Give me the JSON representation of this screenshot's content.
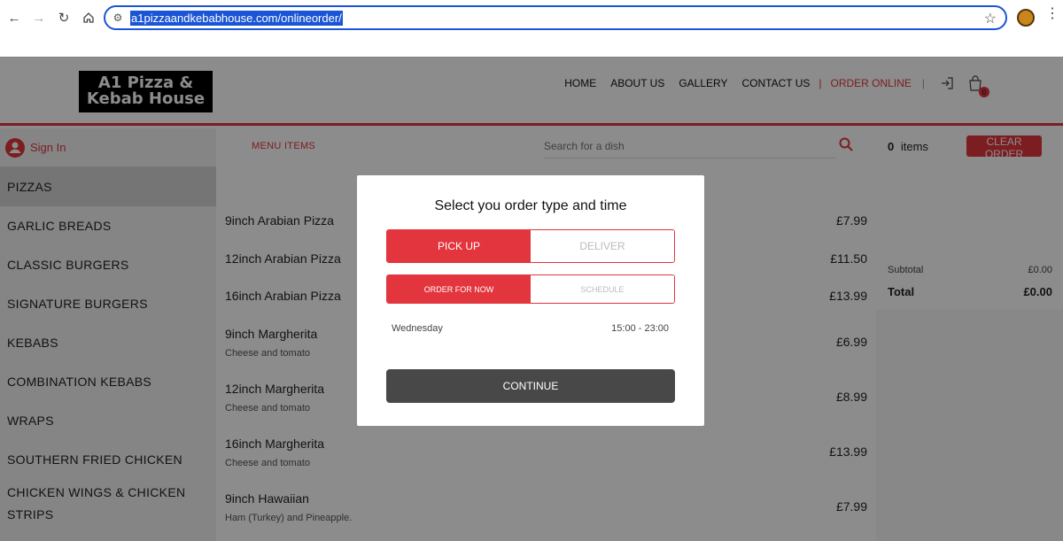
{
  "browser": {
    "url": "a1pizzaandkebabhouse.com/onlineorder/"
  },
  "site": {
    "logo_line1": "A1 Pizza &",
    "logo_line2": "Kebab House",
    "nav": {
      "home": "HOME",
      "about": "ABOUT US",
      "gallery": "GALLERY",
      "contact": "CONTACT US",
      "order": "ORDER ONLINE",
      "cart_count": "0"
    },
    "accent_color": "#e2353d"
  },
  "sidebar": {
    "signin": "Sign In",
    "categories": [
      "PIZZAS",
      "GARLIC BREADS",
      "CLASSIC BURGERS",
      "SIGNATURE BURGERS",
      "KEBABS",
      "COMBINATION KEBABS",
      "WRAPS",
      "SOUTHERN FRIED CHICKEN",
      "CHICKEN WINGS & CHICKEN",
      "STRIPS"
    ]
  },
  "menu": {
    "tab": "MENU ITEMS",
    "search_placeholder": "Search for a dish",
    "items": [
      {
        "name": "9inch Arabian Pizza",
        "desc": "",
        "price": "£7.99"
      },
      {
        "name": "12inch Arabian Pizza",
        "desc": "",
        "price": "£11.50"
      },
      {
        "name": "16inch Arabian Pizza",
        "desc": "",
        "price": "£13.99"
      },
      {
        "name": "9inch Margherita",
        "desc": "Cheese and tomato",
        "price": "£6.99"
      },
      {
        "name": "12inch Margherita",
        "desc": "Cheese and tomato",
        "price": "£8.99"
      },
      {
        "name": "16inch Margherita",
        "desc": "Cheese and tomato",
        "price": "£13.99"
      },
      {
        "name": "9inch Hawaiian",
        "desc": "Ham (Turkey) and Pineapple.",
        "price": "£7.99"
      }
    ]
  },
  "basket": {
    "count": "0",
    "items_label": "items",
    "clear_label": "CLEAR ORDER",
    "subtotal_label": "Subtotal",
    "subtotal_value": "£0.00",
    "total_label": "Total",
    "total_value": "£0.00"
  },
  "modal": {
    "title": "Select you order type and time",
    "pickup": "PICK UP",
    "deliver": "DELIVER",
    "order_now": "ORDER FOR NOW",
    "schedule": "SCHEDULE",
    "day": "Wednesday",
    "hours": "15:00 - 23:00",
    "continue": "CONTINUE"
  }
}
